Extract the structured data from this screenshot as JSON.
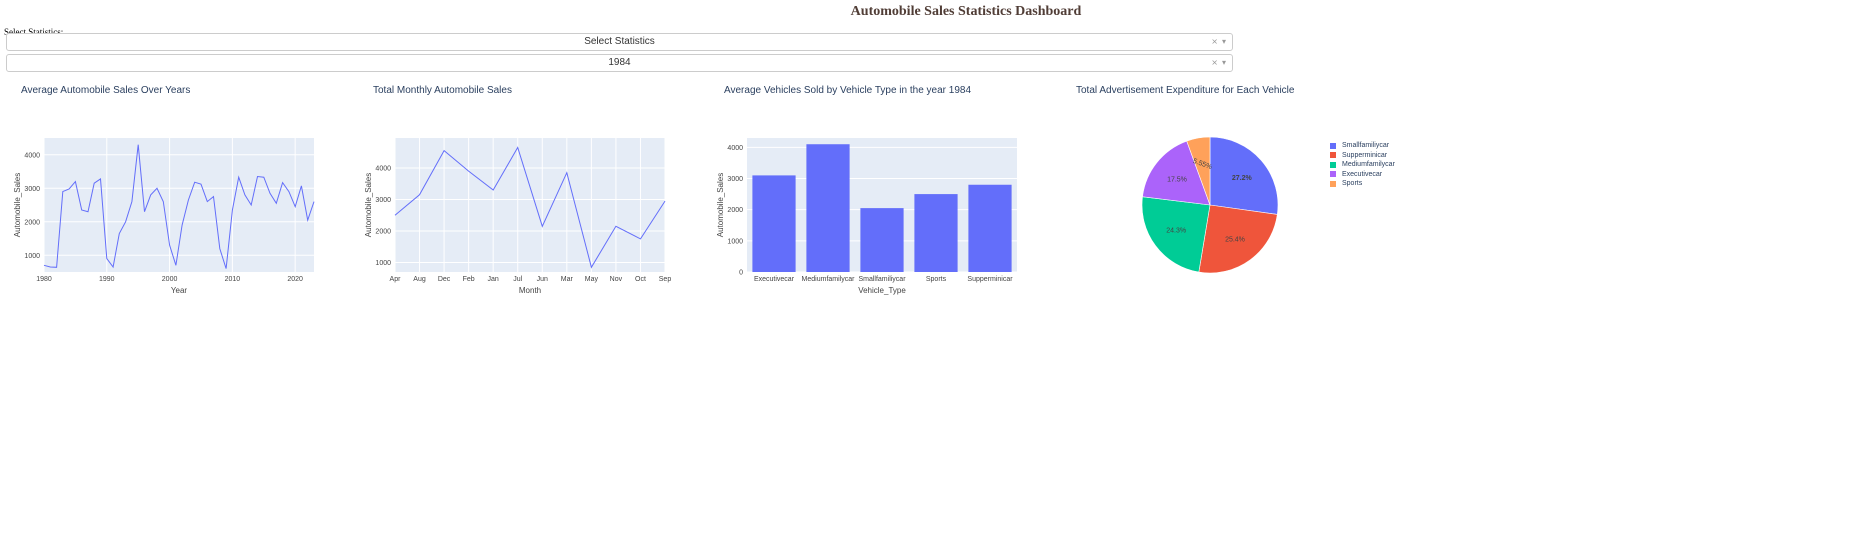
{
  "header": {
    "title": "Automobile Sales Statistics Dashboard"
  },
  "controls": {
    "select_label": "Select Statistics:",
    "statistics_value": "Select Statistics",
    "year_value": "1984",
    "clear_glyph": "×",
    "arrow_glyph": "▾"
  },
  "chart_data": [
    {
      "type": "line",
      "title": "Average Automobile Sales Over Years",
      "xlabel": "Year",
      "ylabel": "Automobile_Sales",
      "xlim": [
        1980,
        2023
      ],
      "ylim": [
        500,
        4500
      ],
      "xticks": [
        1980,
        1990,
        2000,
        2010,
        2020
      ],
      "yticks": [
        1000,
        2000,
        3000,
        4000
      ],
      "color": "#636efa",
      "x": [
        1980,
        1981,
        1982,
        1983,
        1984,
        1985,
        1986,
        1987,
        1988,
        1989,
        1990,
        1991,
        1992,
        1993,
        1994,
        1995,
        1996,
        1997,
        1998,
        1999,
        2000,
        2001,
        2002,
        2003,
        2004,
        2005,
        2006,
        2007,
        2008,
        2009,
        2010,
        2011,
        2012,
        2013,
        2014,
        2015,
        2016,
        2017,
        2018,
        2019,
        2020,
        2021,
        2022,
        2023
      ],
      "y": [
        700,
        650,
        640,
        2900,
        2980,
        3200,
        2350,
        2300,
        3150,
        3280,
        900,
        650,
        1650,
        2000,
        2600,
        4300,
        2300,
        2800,
        3000,
        2600,
        1300,
        700,
        1900,
        2650,
        3180,
        3120,
        2600,
        2750,
        1200,
        600,
        2350,
        3330,
        2800,
        2500,
        3350,
        3330,
        2850,
        2550,
        3170,
        2900,
        2450,
        3070,
        2050,
        2600
      ]
    },
    {
      "type": "line",
      "title": "Total Monthly Automobile Sales",
      "xlabel": "Month",
      "ylabel": "Automobile_Sales",
      "categories": [
        "Apr",
        "Aug",
        "Dec",
        "Feb",
        "Jan",
        "Jul",
        "Jun",
        "Mar",
        "May",
        "Nov",
        "Oct",
        "Sep"
      ],
      "values": [
        2500,
        3150,
        4550,
        3900,
        3300,
        4650,
        2150,
        3850,
        850,
        2150,
        1750,
        2950
      ],
      "ylim": [
        700,
        4950
      ],
      "yticks": [
        1000,
        2000,
        3000,
        4000
      ],
      "color": "#636efa"
    },
    {
      "type": "bar",
      "title": "Average Vehicles Sold by Vehicle Type in the year 1984",
      "xlabel": "Vehicle_Type",
      "ylabel": "Automobile_Sales",
      "categories": [
        "Executivecar",
        "Mediumfamilycar",
        "Smallfamiliycar",
        "Sports",
        "Supperminicar"
      ],
      "values": [
        3100,
        4100,
        2050,
        2500,
        2800
      ],
      "ylim": [
        0,
        4300
      ],
      "yticks": [
        0,
        1000,
        2000,
        3000,
        4000
      ],
      "color": "#636efa"
    },
    {
      "type": "pie",
      "title": "Total Advertisement Expenditure for Each Vehicle",
      "labels": [
        "Smallfamiliycar",
        "Supperminicar",
        "Mediumfamilycar",
        "Executivecar",
        "Sports"
      ],
      "values": [
        27.2,
        25.4,
        24.3,
        17.5,
        5.55
      ],
      "display": [
        "27.2%",
        "25.4%",
        "24.3%",
        "17.5%",
        "5.55%"
      ],
      "colors": [
        "#636efa",
        "#ef553b",
        "#00cc96",
        "#ab63fa",
        "#ffa15a"
      ],
      "legend_position": "right"
    }
  ]
}
